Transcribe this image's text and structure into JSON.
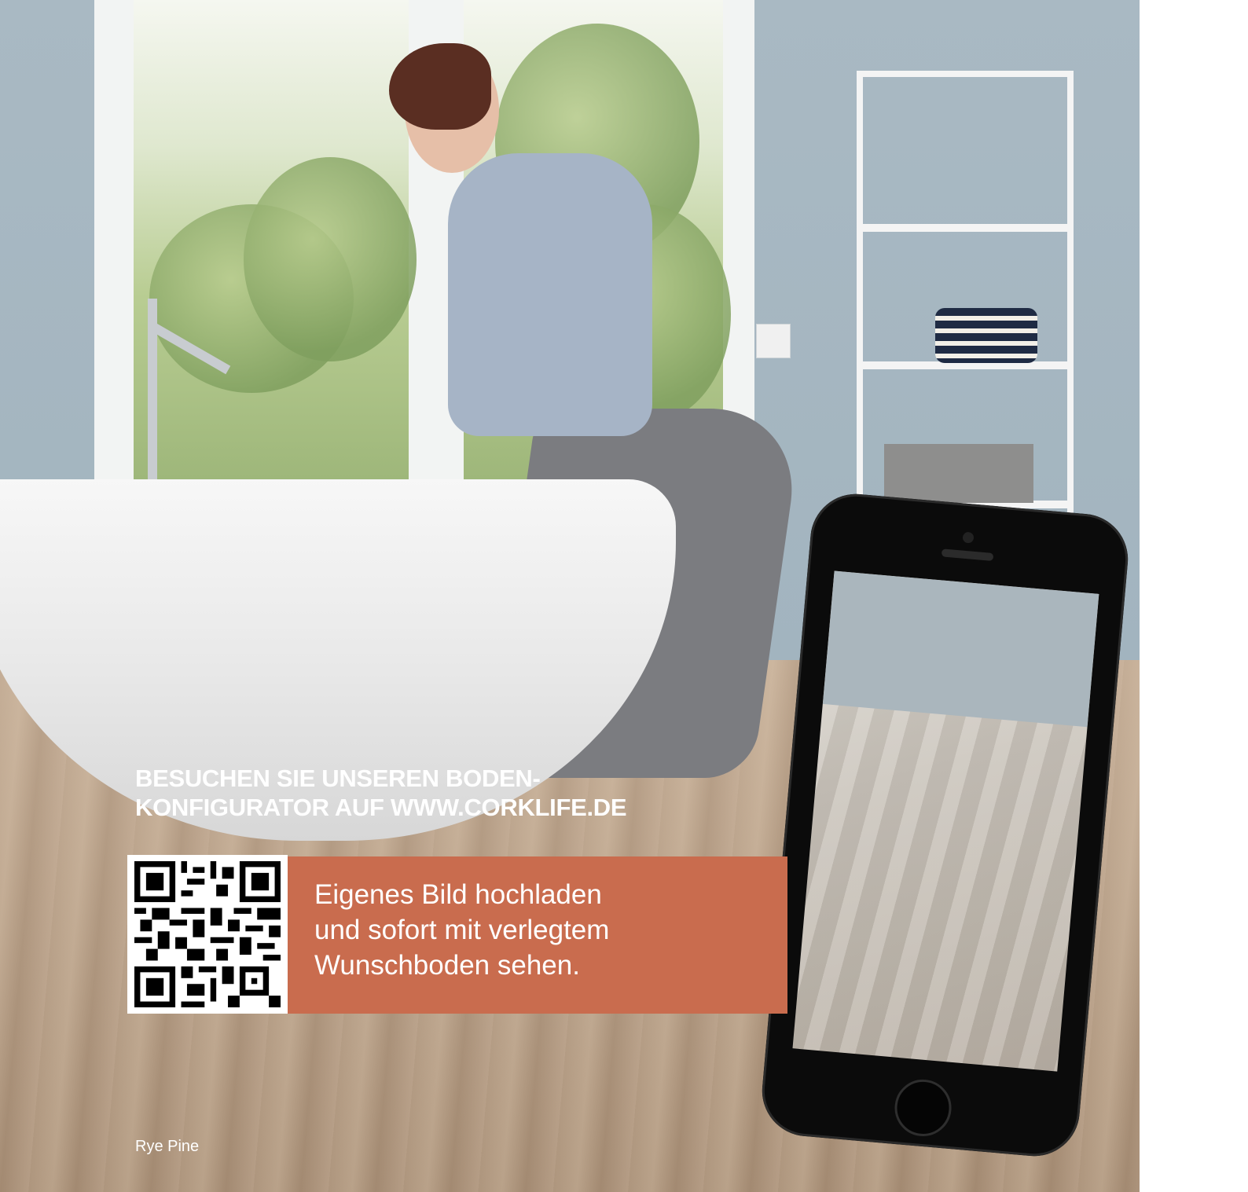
{
  "headline": {
    "line1": "BESUCHEN SIE UNSEREN BODEN-",
    "line2": "KONFIGURATOR AUF WWW.CORKLIFE.DE"
  },
  "promo": {
    "line1": "Eigenes Bild hochladen",
    "line2": "und sofort mit verlegtem",
    "line3": "Wunschboden sehen.",
    "background_color": "#c96c4e"
  },
  "caption": "Rye Pine",
  "qr_code": {
    "icon": "qr-code-icon"
  },
  "phone": {
    "icon": "smartphone-icon"
  }
}
